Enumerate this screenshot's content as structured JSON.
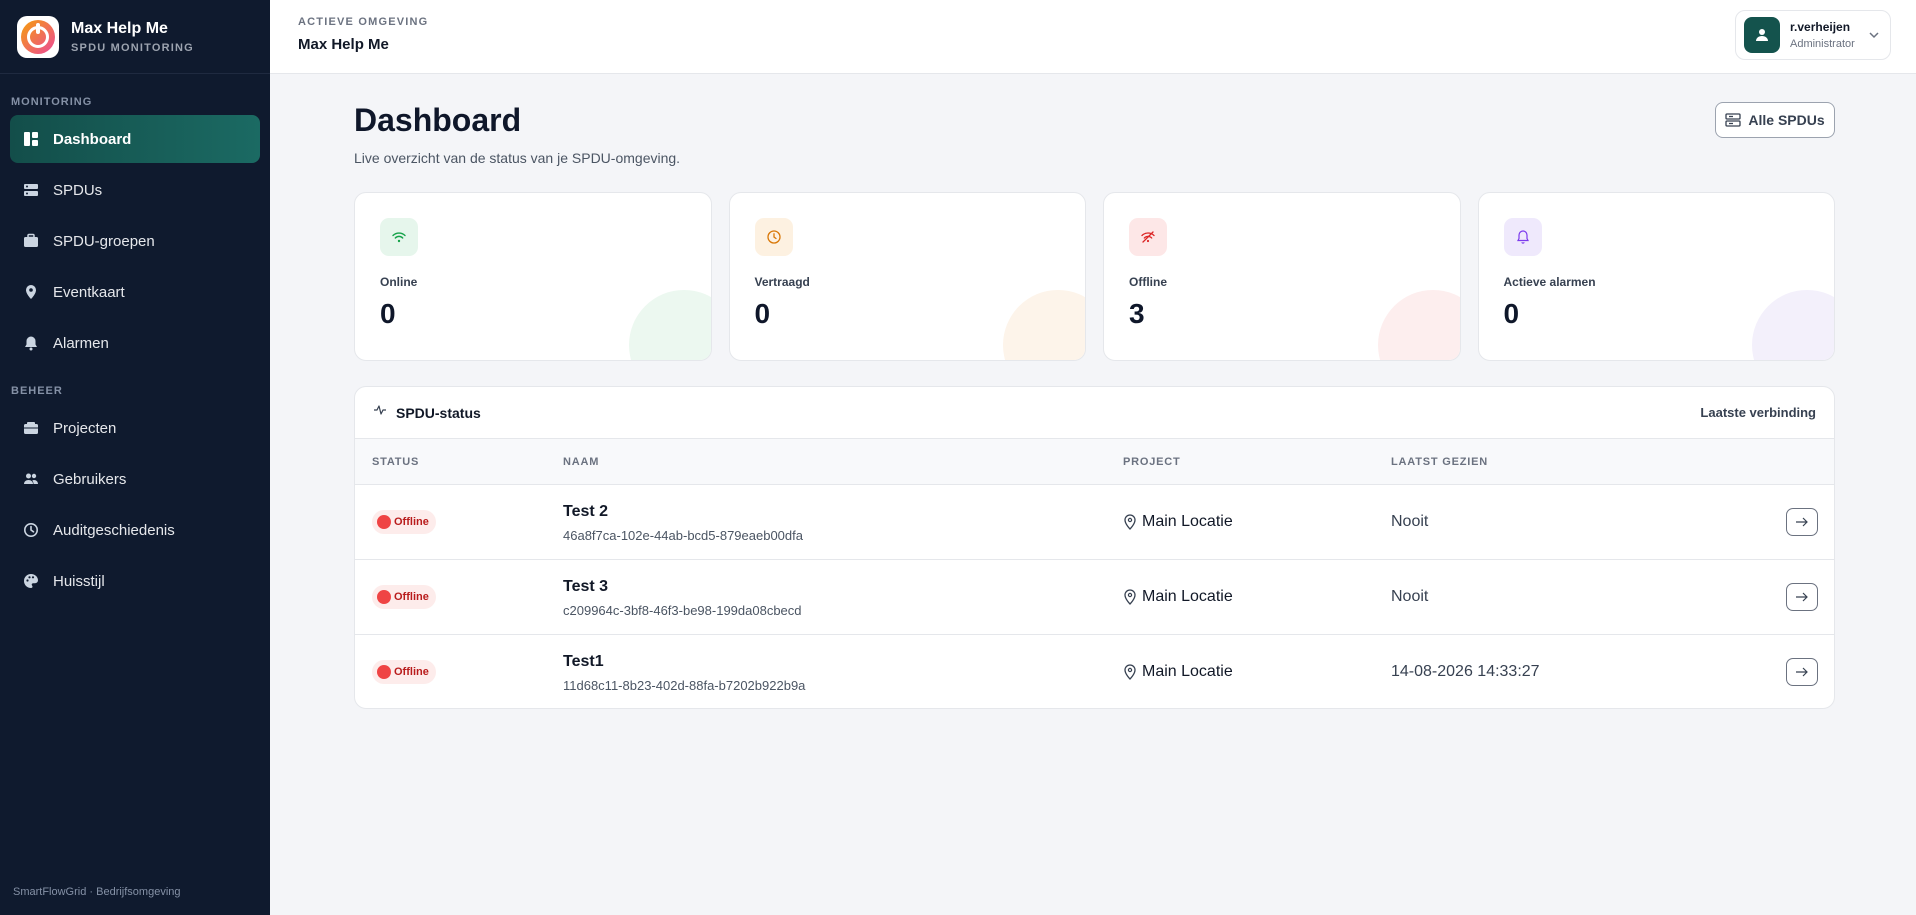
{
  "brand": {
    "name": "Max Help Me",
    "subtitle": "SPDU MONITORING"
  },
  "sidebar": {
    "section_monitoring": "MONITORING",
    "section_beheer": "BEHEER",
    "items": [
      {
        "label": "Dashboard",
        "icon": "dashboard-icon",
        "active": true
      },
      {
        "label": "SPDUs",
        "icon": "server-icon"
      },
      {
        "label": "SPDU-groepen",
        "icon": "briefcase-icon"
      },
      {
        "label": "Eventkaart",
        "icon": "map-pin-icon"
      },
      {
        "label": "Alarmen",
        "icon": "bell-icon"
      },
      {
        "label": "Projecten",
        "icon": "folder-icon"
      },
      {
        "label": "Gebruikers",
        "icon": "users-icon"
      },
      {
        "label": "Auditgeschiedenis",
        "icon": "history-icon"
      },
      {
        "label": "Huisstijl",
        "icon": "palette-icon"
      }
    ],
    "footer": "SmartFlowGrid · Bedrijfsomgeving"
  },
  "topbar": {
    "env_label": "ACTIEVE OMGEVING",
    "env_name": "Max Help Me",
    "user_name": "r.verheijen",
    "user_role": "Administrator"
  },
  "page": {
    "title": "Dashboard",
    "subtitle": "Live overzicht van de status van je SPDU-omgeving.",
    "all_button": "Alle SPDUs"
  },
  "cards": [
    {
      "label": "Online",
      "value": "0",
      "icon": "wifi-icon",
      "color": "#16a34a",
      "bg": "#e6f6ec",
      "blob": "#ecf8f0"
    },
    {
      "label": "Vertraagd",
      "value": "0",
      "icon": "clock-icon",
      "color": "#d97706",
      "bg": "#fdf1e1",
      "blob": "#fdf4ea"
    },
    {
      "label": "Offline",
      "value": "3",
      "icon": "wifi-off-icon",
      "color": "#dc2626",
      "bg": "#fde7e7",
      "blob": "#fdeeee"
    },
    {
      "label": "Actieve alarmen",
      "value": "0",
      "icon": "bell-icon",
      "color": "#7c3aed",
      "bg": "#efe9fc",
      "blob": "#f3f0fb"
    }
  ],
  "status_panel": {
    "title": "SPDU-status",
    "right_label": "Laatste verbinding",
    "columns": [
      "STATUS",
      "NAAM",
      "PROJECT",
      "LAATST GEZIEN"
    ],
    "rows": [
      {
        "status": "Offline",
        "name": "Test 2",
        "id": "46a8f7ca-102e-44ab-bcd5-879eaeb00dfa",
        "project": "Main Locatie",
        "last_seen": "Nooit"
      },
      {
        "status": "Offline",
        "name": "Test 3",
        "id": "c209964c-3bf8-46f3-be98-199da08cbecd",
        "project": "Main Locatie",
        "last_seen": "Nooit"
      },
      {
        "status": "Offline",
        "name": "Test1",
        "id": "11d68c11-8b23-402d-88fa-b7202b922b9a",
        "project": "Main Locatie",
        "last_seen": "14-08-2026 14:33:27"
      }
    ]
  }
}
